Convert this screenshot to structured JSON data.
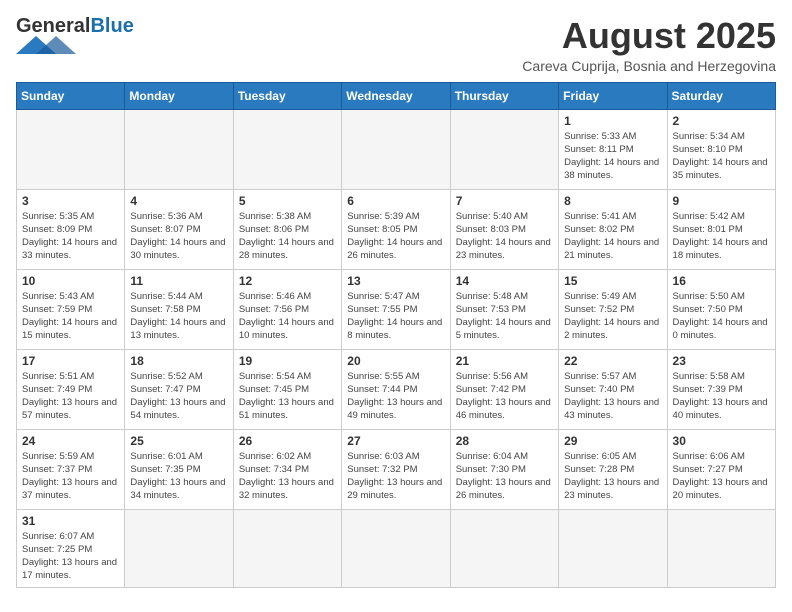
{
  "logo": {
    "general": "General",
    "blue": "Blue"
  },
  "header": {
    "title": "August 2025",
    "subtitle": "Careva Cuprija, Bosnia and Herzegovina"
  },
  "weekdays": [
    "Sunday",
    "Monday",
    "Tuesday",
    "Wednesday",
    "Thursday",
    "Friday",
    "Saturday"
  ],
  "weeks": [
    [
      {
        "day": "",
        "info": ""
      },
      {
        "day": "",
        "info": ""
      },
      {
        "day": "",
        "info": ""
      },
      {
        "day": "",
        "info": ""
      },
      {
        "day": "",
        "info": ""
      },
      {
        "day": "1",
        "info": "Sunrise: 5:33 AM\nSunset: 8:11 PM\nDaylight: 14 hours and 38 minutes."
      },
      {
        "day": "2",
        "info": "Sunrise: 5:34 AM\nSunset: 8:10 PM\nDaylight: 14 hours and 35 minutes."
      }
    ],
    [
      {
        "day": "3",
        "info": "Sunrise: 5:35 AM\nSunset: 8:09 PM\nDaylight: 14 hours and 33 minutes."
      },
      {
        "day": "4",
        "info": "Sunrise: 5:36 AM\nSunset: 8:07 PM\nDaylight: 14 hours and 30 minutes."
      },
      {
        "day": "5",
        "info": "Sunrise: 5:38 AM\nSunset: 8:06 PM\nDaylight: 14 hours and 28 minutes."
      },
      {
        "day": "6",
        "info": "Sunrise: 5:39 AM\nSunset: 8:05 PM\nDaylight: 14 hours and 26 minutes."
      },
      {
        "day": "7",
        "info": "Sunrise: 5:40 AM\nSunset: 8:03 PM\nDaylight: 14 hours and 23 minutes."
      },
      {
        "day": "8",
        "info": "Sunrise: 5:41 AM\nSunset: 8:02 PM\nDaylight: 14 hours and 21 minutes."
      },
      {
        "day": "9",
        "info": "Sunrise: 5:42 AM\nSunset: 8:01 PM\nDaylight: 14 hours and 18 minutes."
      }
    ],
    [
      {
        "day": "10",
        "info": "Sunrise: 5:43 AM\nSunset: 7:59 PM\nDaylight: 14 hours and 15 minutes."
      },
      {
        "day": "11",
        "info": "Sunrise: 5:44 AM\nSunset: 7:58 PM\nDaylight: 14 hours and 13 minutes."
      },
      {
        "day": "12",
        "info": "Sunrise: 5:46 AM\nSunset: 7:56 PM\nDaylight: 14 hours and 10 minutes."
      },
      {
        "day": "13",
        "info": "Sunrise: 5:47 AM\nSunset: 7:55 PM\nDaylight: 14 hours and 8 minutes."
      },
      {
        "day": "14",
        "info": "Sunrise: 5:48 AM\nSunset: 7:53 PM\nDaylight: 14 hours and 5 minutes."
      },
      {
        "day": "15",
        "info": "Sunrise: 5:49 AM\nSunset: 7:52 PM\nDaylight: 14 hours and 2 minutes."
      },
      {
        "day": "16",
        "info": "Sunrise: 5:50 AM\nSunset: 7:50 PM\nDaylight: 14 hours and 0 minutes."
      }
    ],
    [
      {
        "day": "17",
        "info": "Sunrise: 5:51 AM\nSunset: 7:49 PM\nDaylight: 13 hours and 57 minutes."
      },
      {
        "day": "18",
        "info": "Sunrise: 5:52 AM\nSunset: 7:47 PM\nDaylight: 13 hours and 54 minutes."
      },
      {
        "day": "19",
        "info": "Sunrise: 5:54 AM\nSunset: 7:45 PM\nDaylight: 13 hours and 51 minutes."
      },
      {
        "day": "20",
        "info": "Sunrise: 5:55 AM\nSunset: 7:44 PM\nDaylight: 13 hours and 49 minutes."
      },
      {
        "day": "21",
        "info": "Sunrise: 5:56 AM\nSunset: 7:42 PM\nDaylight: 13 hours and 46 minutes."
      },
      {
        "day": "22",
        "info": "Sunrise: 5:57 AM\nSunset: 7:40 PM\nDaylight: 13 hours and 43 minutes."
      },
      {
        "day": "23",
        "info": "Sunrise: 5:58 AM\nSunset: 7:39 PM\nDaylight: 13 hours and 40 minutes."
      }
    ],
    [
      {
        "day": "24",
        "info": "Sunrise: 5:59 AM\nSunset: 7:37 PM\nDaylight: 13 hours and 37 minutes."
      },
      {
        "day": "25",
        "info": "Sunrise: 6:01 AM\nSunset: 7:35 PM\nDaylight: 13 hours and 34 minutes."
      },
      {
        "day": "26",
        "info": "Sunrise: 6:02 AM\nSunset: 7:34 PM\nDaylight: 13 hours and 32 minutes."
      },
      {
        "day": "27",
        "info": "Sunrise: 6:03 AM\nSunset: 7:32 PM\nDaylight: 13 hours and 29 minutes."
      },
      {
        "day": "28",
        "info": "Sunrise: 6:04 AM\nSunset: 7:30 PM\nDaylight: 13 hours and 26 minutes."
      },
      {
        "day": "29",
        "info": "Sunrise: 6:05 AM\nSunset: 7:28 PM\nDaylight: 13 hours and 23 minutes."
      },
      {
        "day": "30",
        "info": "Sunrise: 6:06 AM\nSunset: 7:27 PM\nDaylight: 13 hours and 20 minutes."
      }
    ],
    [
      {
        "day": "31",
        "info": "Sunrise: 6:07 AM\nSunset: 7:25 PM\nDaylight: 13 hours and 17 minutes."
      },
      {
        "day": "",
        "info": ""
      },
      {
        "day": "",
        "info": ""
      },
      {
        "day": "",
        "info": ""
      },
      {
        "day": "",
        "info": ""
      },
      {
        "day": "",
        "info": ""
      },
      {
        "day": "",
        "info": ""
      }
    ]
  ]
}
